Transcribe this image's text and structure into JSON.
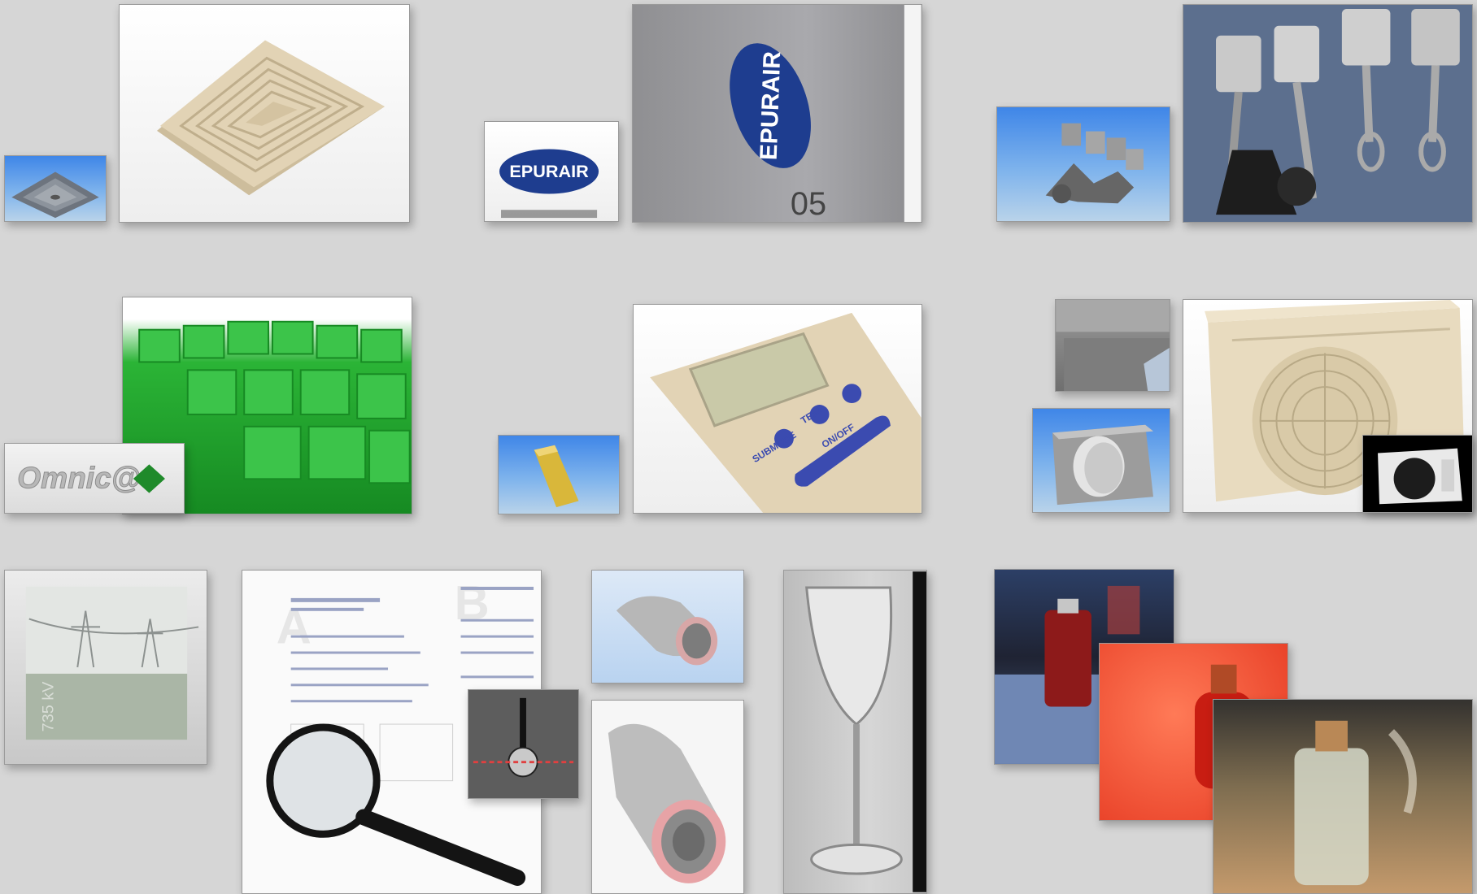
{
  "gallery": {
    "ceiling_vent_thumb": {
      "label": "Ceiling vent render (small)"
    },
    "ceiling_vent": {
      "label": "Ceiling vent render"
    },
    "epurair_card": {
      "logo_text": "EPURAIR"
    },
    "epurair_panel": {
      "logo_text": "EPURAIR",
      "model_text": "05"
    },
    "pistons_thumb": {
      "label": "Engine pistons (small)"
    },
    "pistons": {
      "label": "Engine pistons"
    },
    "green_cubes": {
      "label": "Green cubes"
    },
    "omnica_card": {
      "logo_text": "Omnic@"
    },
    "gold_remote_thumb": {
      "label": "Remote (small)"
    },
    "remote": {
      "buttons": [
        "SUBMODE",
        "TEMP",
        "ON/OFF"
      ]
    },
    "ac_top_thumb": {
      "label": "AC unit top"
    },
    "ac_gray_thumb": {
      "label": "AC unit gray"
    },
    "ac_unit": {
      "label": "AC outdoor unit"
    },
    "ac_dark_thumb": {
      "label": "AC unit dark"
    },
    "power_lines": {
      "voltage_text": "735 kV"
    },
    "form_document": {
      "section_letters": [
        "A",
        "B"
      ]
    },
    "bulb_thumb": {
      "label": "Bulb probe"
    },
    "duct_small": {
      "label": "Flexible duct"
    },
    "duct_large": {
      "label": "Flexible duct large"
    },
    "wine_glass": {
      "label": "Wine glass"
    },
    "perfume_night": {
      "label": "Perfume night"
    },
    "perfume_red": {
      "label": "Perfume red"
    },
    "perfume_wood": {
      "label": "Perfume wood"
    }
  },
  "colors": {
    "background": "#d6d6d6",
    "beige": "#e2d3b5",
    "brand_blue": "#1e3d8f",
    "green": "#22a52e",
    "red_bg": "#f2452a"
  }
}
